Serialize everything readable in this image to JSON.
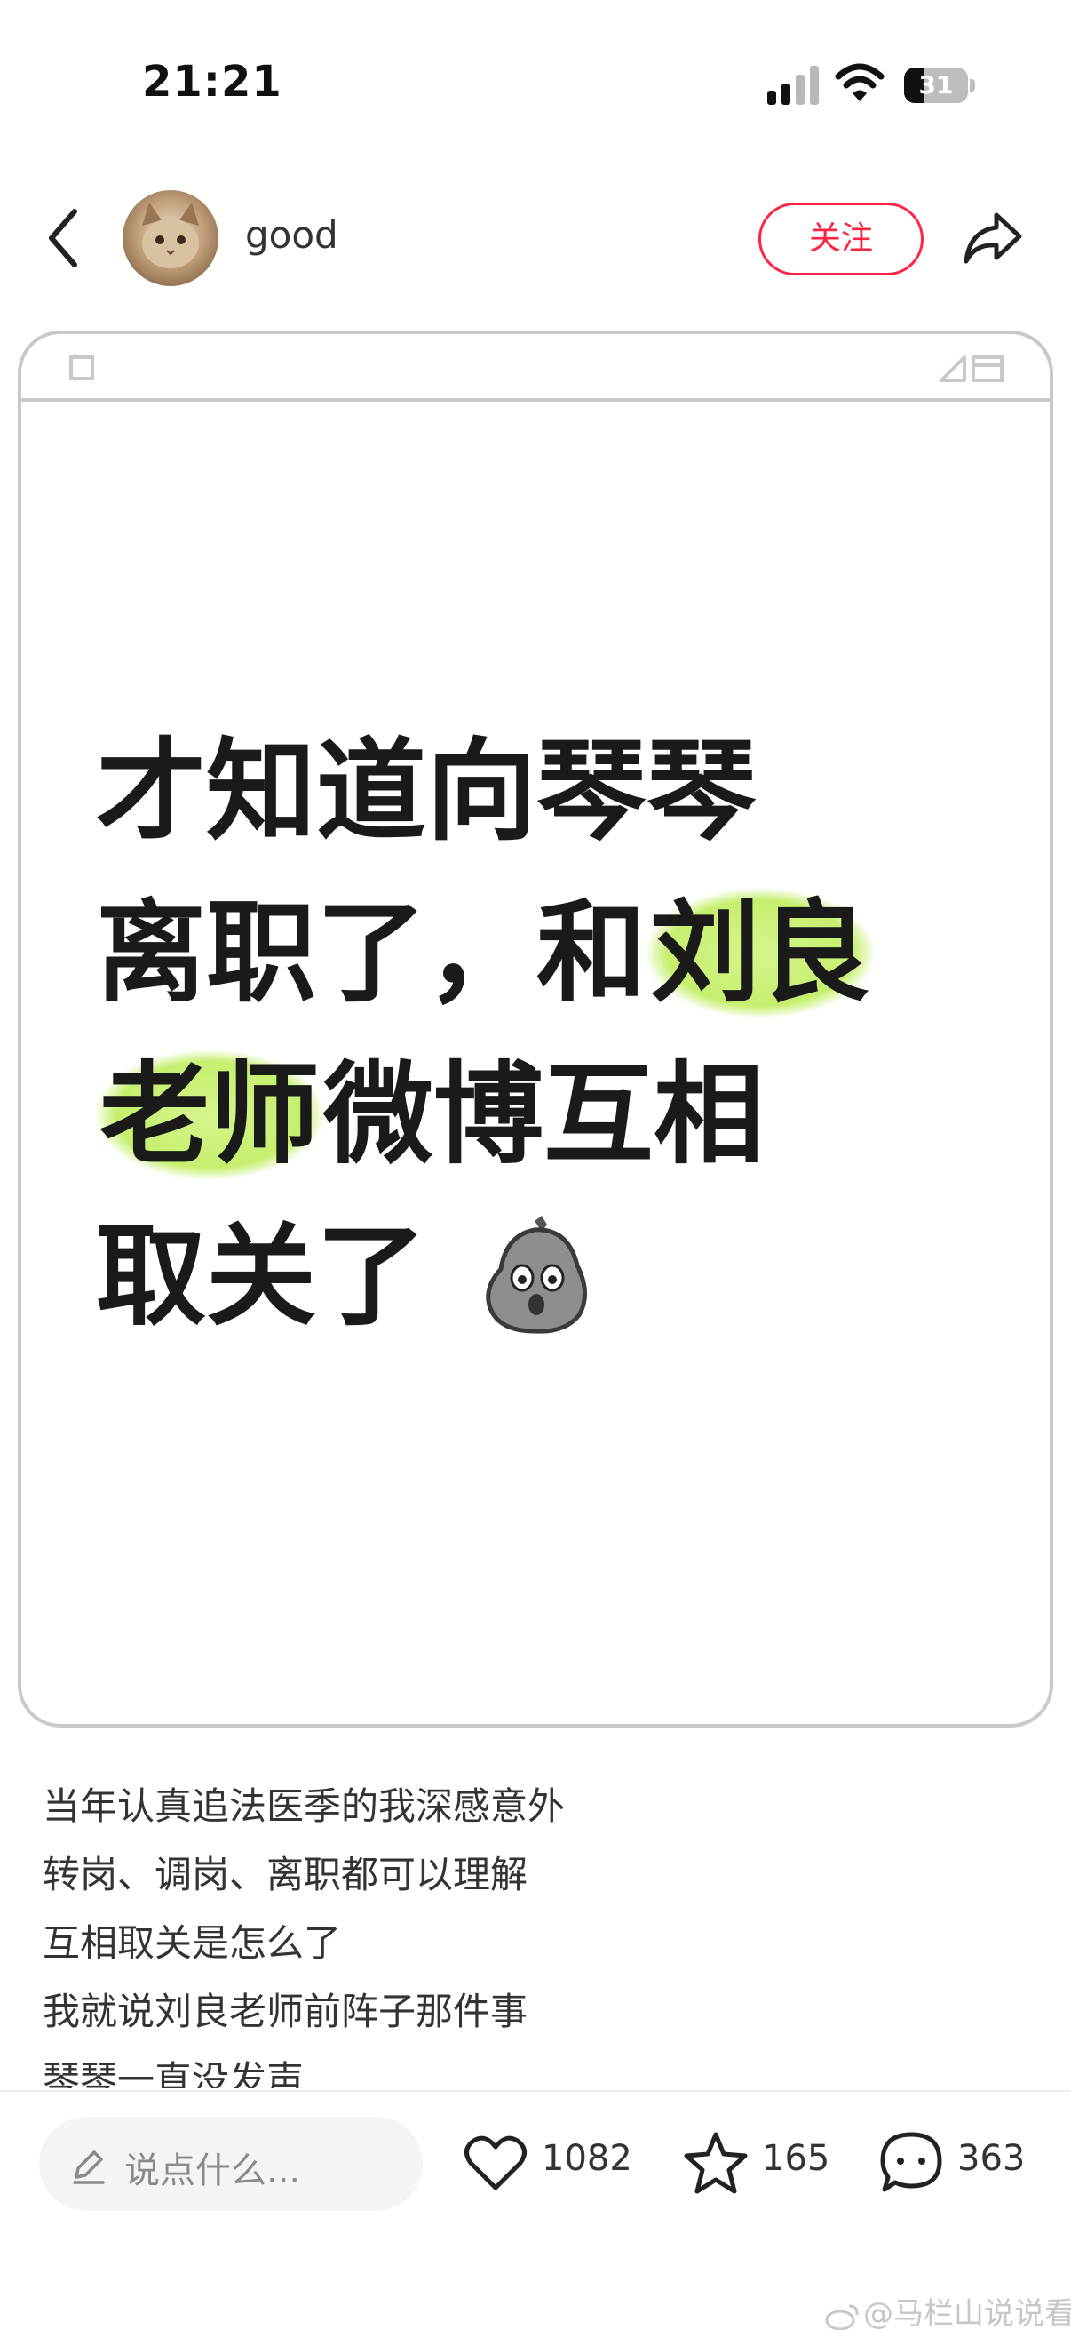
{
  "status_bar": {
    "time": "21:21",
    "battery_level": "31",
    "battery_fraction": 0.31
  },
  "header": {
    "author_name": "good",
    "follow_label": "关注",
    "icons": [
      "back-icon",
      "avatar",
      "share-icon"
    ]
  },
  "post_image": {
    "headline_lines": [
      {
        "before": "才知道向琴琴",
        "highlight": "",
        "after": ""
      },
      {
        "before": "离职了，和",
        "highlight": "刘良",
        "after": ""
      },
      {
        "before": "",
        "highlight": "老师",
        "after": "微博互相"
      },
      {
        "before": "取关了",
        "highlight": "",
        "after": ""
      }
    ],
    "emoji": "shocked-rock-emoji",
    "highlight_color": "#c6ef6e"
  },
  "caption": {
    "lines": [
      "当年认真追法医季的我深感意外",
      "转岗、调岗、离职都可以理解",
      "互相取关是怎么了",
      "我就说刘良老师前阵子那件事",
      "琴琴一直没发声"
    ]
  },
  "bottom_bar": {
    "comment_placeholder": "说点什么...",
    "likes": "1082",
    "favorites": "165",
    "comments": "363"
  },
  "watermark": "@马栏山说说看",
  "colors": {
    "accent": "#ff2442",
    "text": "#333333",
    "border": "#c9c9c9"
  }
}
